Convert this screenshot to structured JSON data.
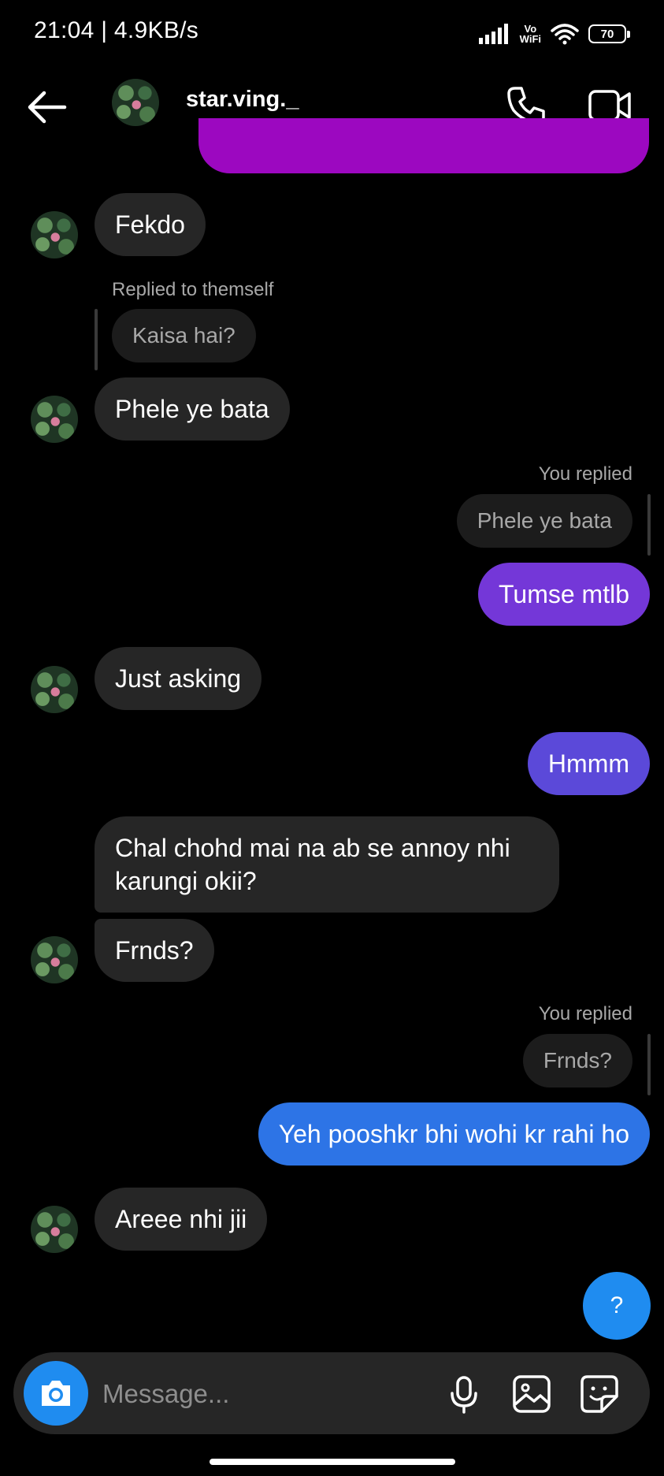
{
  "status_bar": {
    "time": "21:04 | 4.9KB/s",
    "volte_top": "Vo",
    "volte_bottom": "WiFi",
    "battery": "70"
  },
  "header": {
    "username": "star.ving._"
  },
  "messages": {
    "m1": "Fekdo",
    "reply1_label": "Replied to themself",
    "reply1_quote": "Kaisa hai?",
    "m2": "Phele ye bata",
    "reply2_label": "You replied",
    "reply2_quote": "Phele ye bata",
    "m3": "Tumse mtlb",
    "m4": "Just asking",
    "m5": "Hmmm",
    "m6_line1": "Chal chohd mai na ab se annoy nhi",
    "m6_line2": "karungi okii?",
    "m7": "Frnds?",
    "reply3_label": "You replied",
    "reply3_quote": "Frnds?",
    "m8": "Yeh pooshkr bhi wohi kr rahi ho",
    "m9": "Areee nhi jii"
  },
  "help_button": "?",
  "composer": {
    "placeholder": "Message..."
  },
  "colors": {
    "accent_blue": "#1f8cf0",
    "out_purple": "#7437d8",
    "out_indigo": "#5b49d9",
    "out_blue": "#2d74e6",
    "incoming": "#262626"
  }
}
